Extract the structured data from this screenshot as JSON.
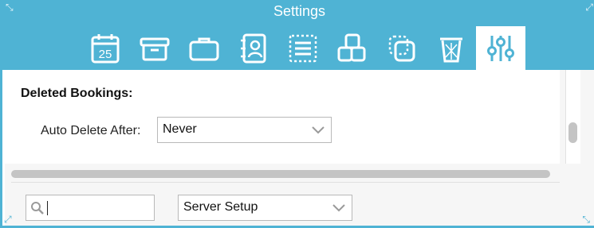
{
  "window": {
    "title": "Settings",
    "accent_color": "#4fb3d4"
  },
  "toolbar": {
    "items": [
      {
        "name": "calendar-icon",
        "text": "25",
        "active": false
      },
      {
        "name": "archive-box-icon",
        "active": false
      },
      {
        "name": "briefcase-icon",
        "active": false
      },
      {
        "name": "contacts-book-icon",
        "active": false
      },
      {
        "name": "list-icon",
        "active": false
      },
      {
        "name": "blocks-icon",
        "active": false
      },
      {
        "name": "duplicate-icon",
        "active": false
      },
      {
        "name": "trash-icon",
        "active": false
      },
      {
        "name": "sliders-icon",
        "active": true
      }
    ]
  },
  "deleted_bookings": {
    "heading": "Deleted Bookings:",
    "auto_delete_label": "Auto Delete After:",
    "auto_delete_value": "Never"
  },
  "footer": {
    "search_value": "",
    "view_select_value": "Server Setup"
  }
}
